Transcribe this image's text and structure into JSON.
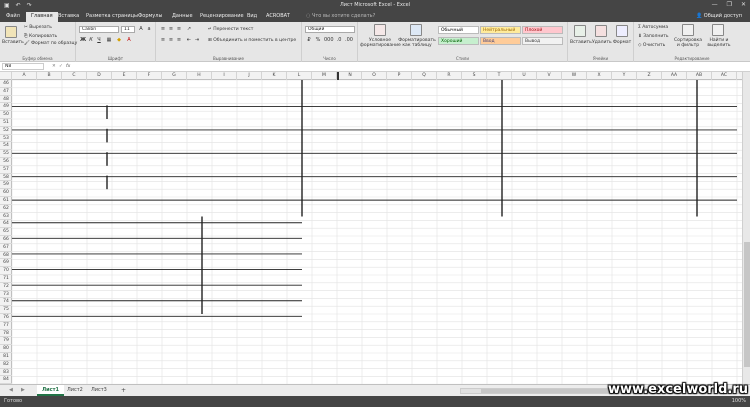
{
  "window": {
    "title": "Лист Microsoft Excel - Excel",
    "quick_access": [
      "save-icon",
      "undo-icon",
      "redo-icon"
    ],
    "controls": [
      "—",
      "❐",
      "✕"
    ]
  },
  "menu": {
    "tabs": [
      "Файл",
      "Главная",
      "Вставка",
      "Разметка страницы",
      "Формулы",
      "Данные",
      "Рецензирование",
      "Вид",
      "ACROBAT"
    ],
    "active_tab": "Главная",
    "tell_me": "Что вы хотите сделать?",
    "share": "Общий доступ"
  },
  "ribbon": {
    "clipboard": {
      "label": "Буфер обмена",
      "paste": "Вставить",
      "cut": "Вырезать",
      "copy": "Копировать",
      "format_painter": "Формат по образцу"
    },
    "font": {
      "label": "Шрифт",
      "name": "Calibri",
      "size": "11"
    },
    "alignment": {
      "label": "Выравнивание",
      "wrap": "Перенести текст",
      "merge": "Объединить и поместить в центре"
    },
    "number": {
      "label": "Число",
      "format": "Общий"
    },
    "styles": {
      "label": "Стили",
      "conditional": "Условное форматирование",
      "as_table": "Форматировать как таблицу",
      "cells": [
        {
          "text": "Обычный",
          "bg": "#ffffff",
          "fg": "#000000"
        },
        {
          "text": "Нейтральный",
          "bg": "#ffeb9c",
          "fg": "#9c6500"
        },
        {
          "text": "Плохой",
          "bg": "#ffc7ce",
          "fg": "#9c0006"
        },
        {
          "text": "Хороший",
          "bg": "#c6efce",
          "fg": "#006100"
        },
        {
          "text": "Ввод",
          "bg": "#ffcc99",
          "fg": "#3f3f76"
        },
        {
          "text": "Вывод",
          "bg": "#f2f2f2",
          "fg": "#3f3f3f"
        }
      ]
    },
    "cells": {
      "label": "Ячейки",
      "insert": "Вставить",
      "delete": "Удалить",
      "format": "Формат"
    },
    "editing": {
      "label": "Редактирование",
      "autosum": "Автосумма",
      "fill": "Заполнить",
      "clear": "Очистить",
      "sort": "Сортировка и фильтр",
      "find": "Найти и выделить"
    }
  },
  "formula_bar": {
    "name_box": "N8",
    "fx": "fx",
    "value": ""
  },
  "columns": [
    "A",
    "B",
    "C",
    "D",
    "E",
    "F",
    "G",
    "H",
    "I",
    "J",
    "K",
    "L",
    "M",
    "N",
    "O",
    "P",
    "Q",
    "R",
    "S",
    "T",
    "U",
    "V",
    "W",
    "X",
    "Y",
    "Z",
    "AA",
    "AB",
    "AC"
  ],
  "rows": [
    "46",
    "47",
    "48",
    "49",
    "50",
    "51",
    "52",
    "53",
    "54",
    "55",
    "56",
    "57",
    "58",
    "59",
    "60",
    "61",
    "62",
    "63",
    "64",
    "65",
    "66",
    "67",
    "68",
    "69",
    "70",
    "71",
    "72",
    "73",
    "74",
    "75",
    "76",
    "77",
    "78",
    "79",
    "80",
    "81",
    "82",
    "83",
    "84"
  ],
  "sheets": {
    "tabs": [
      "Лист1",
      "Лист2",
      "Лист3"
    ],
    "active": "Лист1",
    "add": "+"
  },
  "status": {
    "text": "Готово",
    "zoom": "100%"
  },
  "watermark": "www.excelworld.ru",
  "colors": {
    "chrome": "#454545",
    "ribbon": "#e6e6e6",
    "accent": "#217346",
    "gridline": "#e2e2e2"
  }
}
